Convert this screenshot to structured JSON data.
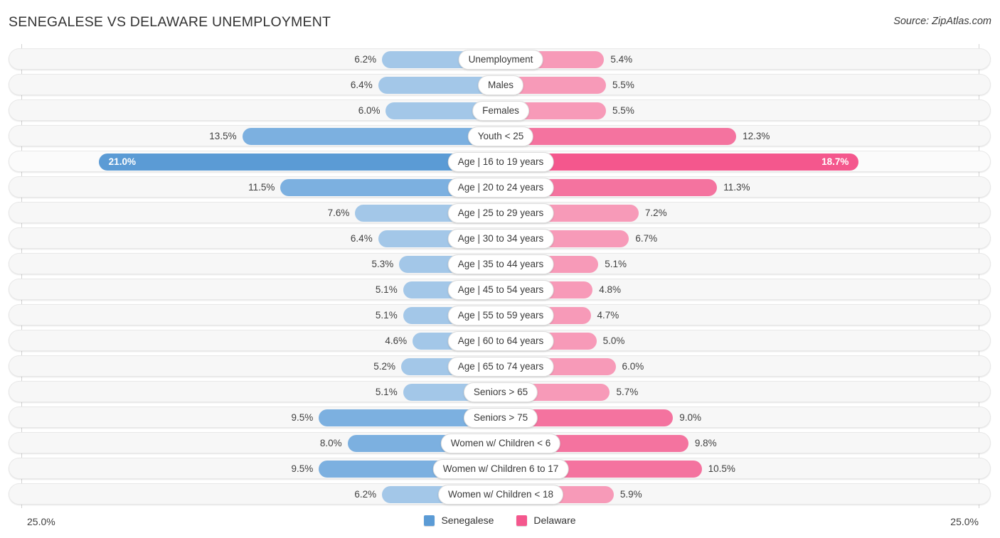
{
  "header": {
    "title": "SENEGALESE VS DELAWARE UNEMPLOYMENT",
    "source": "Source: ZipAtlas.com"
  },
  "footer": {
    "axis_max_left": "25.0%",
    "axis_max_right": "25.0%",
    "legend": [
      {
        "label": "Senegalese",
        "color": "#5b9bd5"
      },
      {
        "label": "Delaware",
        "color": "#f4578d"
      }
    ]
  },
  "colors": {
    "left_normal": "#a3c7e8",
    "left_mid": "#7cb0e0",
    "left_strong": "#5b9bd5",
    "right_normal": "#f79ab8",
    "right_mid": "#f4739f",
    "right_strong": "#f4578d",
    "track": "#f7f7f7",
    "axis": "#d3d3d3"
  },
  "chart_data": {
    "type": "bar",
    "orientation": "horizontal-diverging",
    "title": "SENEGALESE VS DELAWARE UNEMPLOYMENT",
    "xlabel": "",
    "ylabel": "",
    "axis_max": 25.0,
    "unit": "%",
    "grid": false,
    "legend_position": "bottom-center",
    "series": [
      {
        "name": "Senegalese",
        "side": "left",
        "color": "#5b9bd5",
        "values": [
          6.2,
          6.4,
          6.0,
          13.5,
          21.0,
          11.5,
          7.6,
          6.4,
          5.3,
          5.1,
          5.1,
          4.6,
          5.2,
          5.1,
          9.5,
          8.0,
          9.5,
          6.2
        ]
      },
      {
        "name": "Delaware",
        "side": "right",
        "color": "#f4578d",
        "values": [
          5.4,
          5.5,
          5.5,
          12.3,
          18.7,
          11.3,
          7.2,
          6.7,
          5.1,
          4.8,
          4.7,
          5.0,
          6.0,
          5.7,
          9.0,
          9.8,
          10.5,
          5.9
        ]
      }
    ],
    "categories": [
      "Unemployment",
      "Males",
      "Females",
      "Youth < 25",
      "Age | 16 to 19 years",
      "Age | 20 to 24 years",
      "Age | 25 to 29 years",
      "Age | 30 to 34 years",
      "Age | 35 to 44 years",
      "Age | 45 to 54 years",
      "Age | 55 to 59 years",
      "Age | 60 to 64 years",
      "Age | 65 to 74 years",
      "Seniors > 65",
      "Seniors > 75",
      "Women w/ Children < 6",
      "Women w/ Children 6 to 17",
      "Women w/ Children < 18"
    ],
    "rows": [
      {
        "category": "Unemployment",
        "left_value": 6.2,
        "left_label": "6.2%",
        "right_value": 5.4,
        "right_label": "5.4%",
        "emphasis": "normal"
      },
      {
        "category": "Males",
        "left_value": 6.4,
        "left_label": "6.4%",
        "right_value": 5.5,
        "right_label": "5.5%",
        "emphasis": "normal"
      },
      {
        "category": "Females",
        "left_value": 6.0,
        "left_label": "6.0%",
        "right_value": 5.5,
        "right_label": "5.5%",
        "emphasis": "normal"
      },
      {
        "category": "Youth < 25",
        "left_value": 13.5,
        "left_label": "13.5%",
        "right_value": 12.3,
        "right_label": "12.3%",
        "emphasis": "mid"
      },
      {
        "category": "Age | 16 to 19 years",
        "left_value": 21.0,
        "left_label": "21.0%",
        "right_value": 18.7,
        "right_label": "18.7%",
        "emphasis": "strong"
      },
      {
        "category": "Age | 20 to 24 years",
        "left_value": 11.5,
        "left_label": "11.5%",
        "right_value": 11.3,
        "right_label": "11.3%",
        "emphasis": "mid"
      },
      {
        "category": "Age | 25 to 29 years",
        "left_value": 7.6,
        "left_label": "7.6%",
        "right_value": 7.2,
        "right_label": "7.2%",
        "emphasis": "normal"
      },
      {
        "category": "Age | 30 to 34 years",
        "left_value": 6.4,
        "left_label": "6.4%",
        "right_value": 6.7,
        "right_label": "6.7%",
        "emphasis": "normal"
      },
      {
        "category": "Age | 35 to 44 years",
        "left_value": 5.3,
        "left_label": "5.3%",
        "right_value": 5.1,
        "right_label": "5.1%",
        "emphasis": "normal"
      },
      {
        "category": "Age | 45 to 54 years",
        "left_value": 5.1,
        "left_label": "5.1%",
        "right_value": 4.8,
        "right_label": "4.8%",
        "emphasis": "normal"
      },
      {
        "category": "Age | 55 to 59 years",
        "left_value": 5.1,
        "left_label": "5.1%",
        "right_value": 4.7,
        "right_label": "4.7%",
        "emphasis": "normal"
      },
      {
        "category": "Age | 60 to 64 years",
        "left_value": 4.6,
        "left_label": "4.6%",
        "right_value": 5.0,
        "right_label": "5.0%",
        "emphasis": "normal"
      },
      {
        "category": "Age | 65 to 74 years",
        "left_value": 5.2,
        "left_label": "5.2%",
        "right_value": 6.0,
        "right_label": "6.0%",
        "emphasis": "normal"
      },
      {
        "category": "Seniors > 65",
        "left_value": 5.1,
        "left_label": "5.1%",
        "right_value": 5.7,
        "right_label": "5.7%",
        "emphasis": "normal"
      },
      {
        "category": "Seniors > 75",
        "left_value": 9.5,
        "left_label": "9.5%",
        "right_value": 9.0,
        "right_label": "9.0%",
        "emphasis": "mid"
      },
      {
        "category": "Women w/ Children < 6",
        "left_value": 8.0,
        "left_label": "8.0%",
        "right_value": 9.8,
        "right_label": "9.8%",
        "emphasis": "mid"
      },
      {
        "category": "Women w/ Children 6 to 17",
        "left_value": 9.5,
        "left_label": "9.5%",
        "right_value": 10.5,
        "right_label": "10.5%",
        "emphasis": "mid"
      },
      {
        "category": "Women w/ Children < 18",
        "left_value": 6.2,
        "left_label": "6.2%",
        "right_value": 5.9,
        "right_label": "5.9%",
        "emphasis": "normal"
      }
    ]
  }
}
